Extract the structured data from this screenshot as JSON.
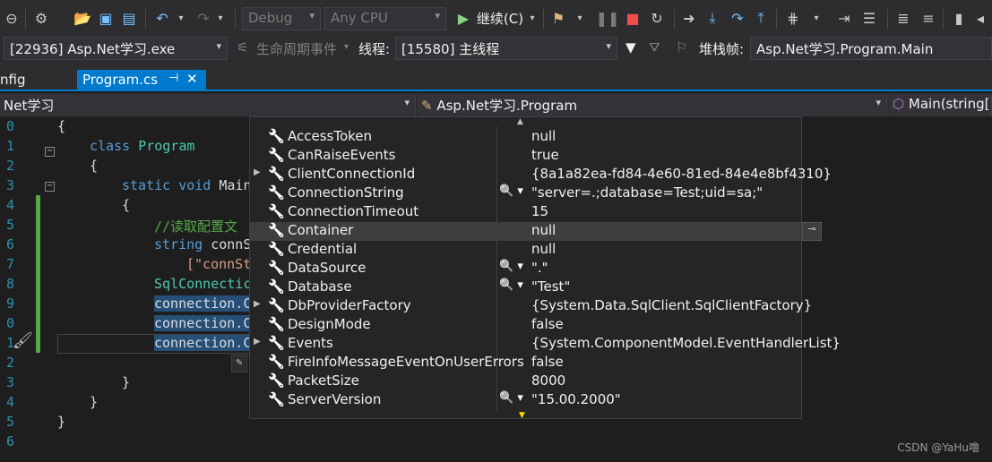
{
  "toolbar": {
    "config": "Debug",
    "platform": "Any CPU",
    "continue_label": "继续(C)"
  },
  "debug_location": {
    "process": "[22936] Asp.Net学习.exe",
    "lifecycle_label": "生命周期事件",
    "thread_label": "线程:",
    "thread_value": "[15580] 主线程",
    "stack_frame_label": "堆栈帧:",
    "stack_frame_value": "Asp.Net学习.Program.Main"
  },
  "tabs": {
    "partial": "nfig",
    "active": "Program.cs"
  },
  "nav": {
    "project": "Net学习",
    "class": "Asp.Net学习.Program",
    "member": "Main(string[]"
  },
  "line_numbers": [
    "0",
    "1",
    "2",
    "3",
    "4",
    "5",
    "6",
    "7",
    "8",
    "9",
    "0",
    "1",
    "2",
    "3",
    "4",
    "5",
    "6"
  ],
  "code": {
    "l0": "{",
    "l1_kw": "class",
    "l1_ty": "Program",
    "l2": "{",
    "l3_kw": "static void",
    "l3_rest": "Main",
    "l4": "{",
    "l5": "//读取配置文",
    "l6_kw": "string",
    "l6_rest": "connS",
    "l7": "[\"connSt",
    "l8": "SqlConnectic",
    "l9": "connection.C",
    "l10": "connection.C",
    "l11": "connection.C",
    "l13": "}",
    "l14": "}",
    "l15": "}"
  },
  "datatip": [
    {
      "name": "AccessToken",
      "value": "null",
      "expandable": false,
      "magnifier": false
    },
    {
      "name": "CanRaiseEvents",
      "value": "true",
      "expandable": false,
      "magnifier": false
    },
    {
      "name": "ClientConnectionId",
      "value": "{8a1a82ea-fd84-4e60-81ed-84e4e8bf4310}",
      "expandable": true,
      "magnifier": false
    },
    {
      "name": "ConnectionString",
      "value": "\"server=.;database=Test;uid=sa;\"",
      "expandable": false,
      "magnifier": true
    },
    {
      "name": "ConnectionTimeout",
      "value": "15",
      "expandable": false,
      "magnifier": false
    },
    {
      "name": "Container",
      "value": "null",
      "expandable": false,
      "magnifier": false
    },
    {
      "name": "Credential",
      "value": "null",
      "expandable": false,
      "magnifier": false
    },
    {
      "name": "DataSource",
      "value": "\".\"",
      "expandable": false,
      "magnifier": true
    },
    {
      "name": "Database",
      "value": "\"Test\"",
      "expandable": false,
      "magnifier": true
    },
    {
      "name": "DbProviderFactory",
      "value": "{System.Data.SqlClient.SqlClientFactory}",
      "expandable": true,
      "magnifier": false
    },
    {
      "name": "DesignMode",
      "value": "false",
      "expandable": false,
      "magnifier": false
    },
    {
      "name": "Events",
      "value": "{System.ComponentModel.EventHandlerList}",
      "expandable": true,
      "magnifier": false
    },
    {
      "name": "FireInfoMessageEventOnUserErrors",
      "value": "false",
      "expandable": false,
      "magnifier": false
    },
    {
      "name": "PacketSize",
      "value": "8000",
      "expandable": false,
      "magnifier": false
    },
    {
      "name": "ServerVersion",
      "value": "\"15.00.2000\"",
      "expandable": false,
      "magnifier": true
    }
  ],
  "watermark": "CSDN @YaHu噜",
  "icons": {
    "property": "wrench-icon",
    "magnifier": "magnifier-icon",
    "expand": "expand-triangle-icon"
  }
}
